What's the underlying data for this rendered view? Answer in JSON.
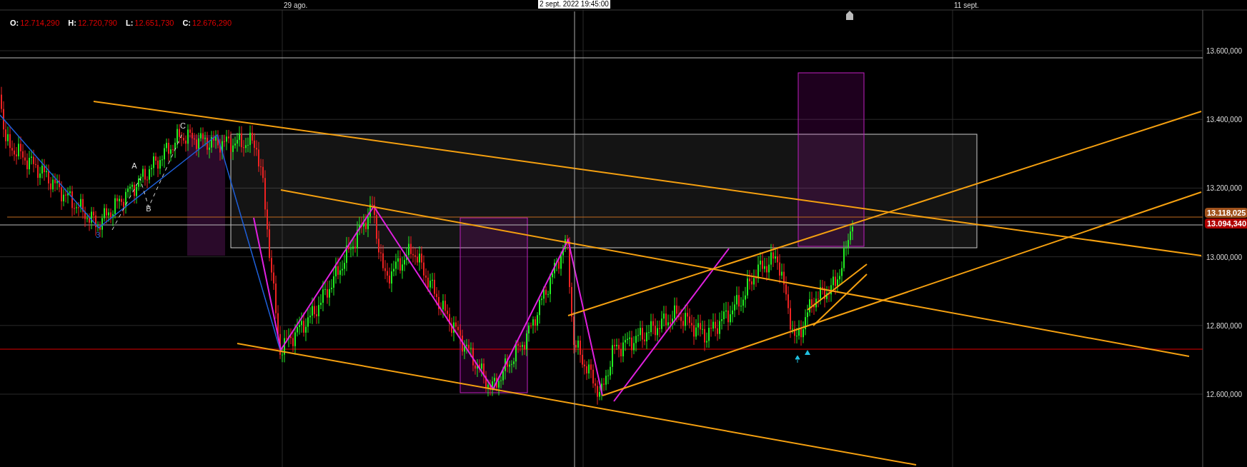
{
  "ohlc": [
    {
      "label": "O:",
      "value": "12.714,290"
    },
    {
      "label": "H:",
      "value": "12.720,790"
    },
    {
      "label": "L:",
      "value": "12.651,730"
    },
    {
      "label": "C:",
      "value": "12.676,290"
    }
  ],
  "time_axis": [
    "29 ago.",
    "11 sept."
  ],
  "crosshair_time": "2 sept. 2022 19:45:00",
  "price_axis": [
    "13.600,000",
    "13.400,000",
    "13.200,000",
    "13.000,000",
    "12.800,000",
    "12.600,000"
  ],
  "price_badges": [
    {
      "text": "13.118,025",
      "color": "#a0521c"
    },
    {
      "text": "13.094,340",
      "color": "#b00000"
    }
  ],
  "wave_labels": [
    "C",
    "A",
    "B",
    "3"
  ]
}
